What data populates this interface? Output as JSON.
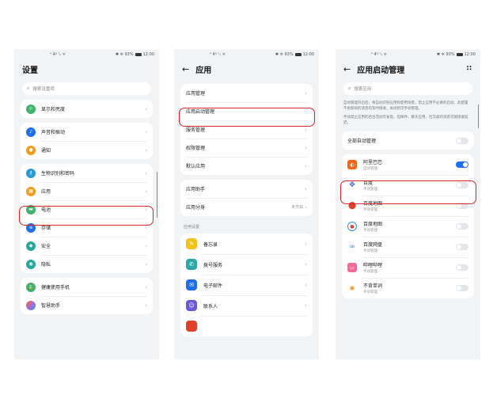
{
  "colors": {
    "accent": "#1e6ff0",
    "highlight": "#d8262c",
    "bg": "#f1f3f5"
  },
  "status": {
    "signal": "ᵃ 4ᵍ ˢᵢₗ ᯤ",
    "right": "✱ ✲ 93%",
    "time": "12:00"
  },
  "screen1": {
    "title": "设置",
    "search_placeholder": "搜索设置项",
    "items": [
      {
        "label": "显示和亮度",
        "icon": "display-icon",
        "color": "#3db36b"
      },
      {
        "label": "声音和振动",
        "icon": "sound-icon",
        "color": "#1e6ff0"
      },
      {
        "label": "通知",
        "icon": "bell-icon",
        "color": "#f29a1a"
      },
      {
        "label": "生物识别和密码",
        "icon": "key-icon",
        "color": "#2b9ad8"
      },
      {
        "label": "应用",
        "icon": "apps-icon",
        "color": "#f29a1a"
      },
      {
        "label": "电池",
        "icon": "battery-icon",
        "color": "#3db36b"
      },
      {
        "label": "存储",
        "icon": "storage-icon",
        "color": "#1e6ff0"
      },
      {
        "label": "安全",
        "icon": "shield-icon",
        "color": "#26a8a0"
      },
      {
        "label": "隐私",
        "icon": "privacy-icon",
        "color": "#26a8a0"
      },
      {
        "label": "健康使用手机",
        "icon": "hourglass-icon",
        "color": "#3db36b"
      },
      {
        "label": "智慧助手",
        "icon": "assistant-icon",
        "color": "#b06ad8"
      }
    ]
  },
  "screen2": {
    "title": "应用",
    "items": [
      {
        "label": "应用管理"
      },
      {
        "label": "应用启动管理"
      },
      {
        "label": "服务管理"
      },
      {
        "label": "权限管理"
      },
      {
        "label": "默认应用"
      },
      {
        "label": "应用助手"
      },
      {
        "label": "应用分身",
        "state": "未开启"
      }
    ],
    "section_label": "应用设置",
    "apps": [
      {
        "label": "备忘录",
        "icon": "memo-icon",
        "color": "#f2c41a"
      },
      {
        "label": "拨号服务",
        "icon": "phone-icon",
        "color": "#2aa8a8"
      },
      {
        "label": "电子邮件",
        "icon": "mail-icon",
        "color": "#1e6ff0"
      },
      {
        "label": "联系人",
        "icon": "contacts-icon",
        "color": "#6a5ad8"
      }
    ]
  },
  "screen3": {
    "title": "应用启动管理",
    "more": "∷",
    "search_placeholder": "搜索应用",
    "desc1": "自动管理开启后，将自动识别应用和使用场景，禁止应用不必要的启动，此配置不会影响的消息的及时接收，关闭则可手动管理。",
    "desc2": "手动禁止应用的后台活动可省电，但邮件、聊天应用、社交类的消息可能接收延迟。",
    "all_label": "全部自动管理",
    "apps": [
      {
        "name": "阿里巴巴",
        "sub": "自动管理",
        "on": true,
        "icon": "alibaba-icon",
        "color": "#f2661a"
      },
      {
        "name": "百度",
        "sub": "手动管理",
        "on": false,
        "icon": "baidu-icon",
        "color": "#2b5fd8"
      },
      {
        "name": "百度地图",
        "sub": "手动管理",
        "on": false,
        "icon": "baidu-map-icon",
        "color": "#e0402a"
      },
      {
        "name": "百度地图",
        "sub": "手动管理",
        "on": false,
        "icon": "map-pin-icon",
        "color": "#2b9ad8"
      },
      {
        "name": "百度网盘",
        "sub": "手动管理",
        "on": false,
        "icon": "cloud-drive-icon",
        "color": "#3a8be8"
      },
      {
        "name": "哔哩哔哩",
        "sub": "手动管理",
        "on": false,
        "icon": "bilibili-icon",
        "color": "#f06a9a"
      },
      {
        "name": "不背单词",
        "sub": "手动管理",
        "on": false,
        "icon": "words-icon",
        "color": "#f29a1a"
      }
    ]
  }
}
